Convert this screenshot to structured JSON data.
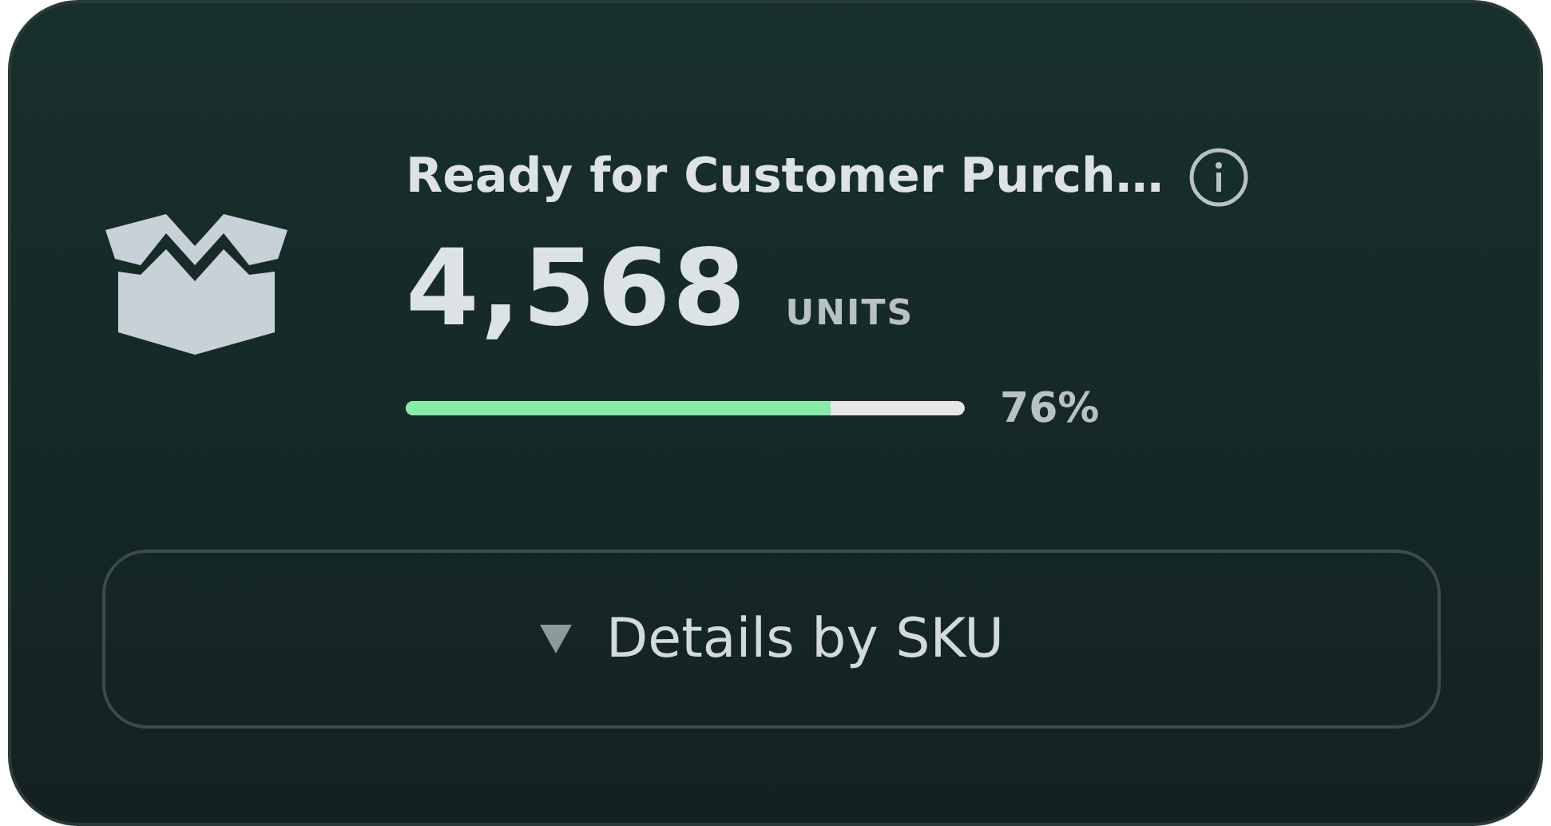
{
  "card": {
    "title": "Ready for Customer Purch…",
    "value": "4,568",
    "unit": "UNITS",
    "progress": {
      "level": 0.76,
      "reading": "76%"
    },
    "details_button": {
      "label": "Details by SKU",
      "expanded": false
    }
  }
}
